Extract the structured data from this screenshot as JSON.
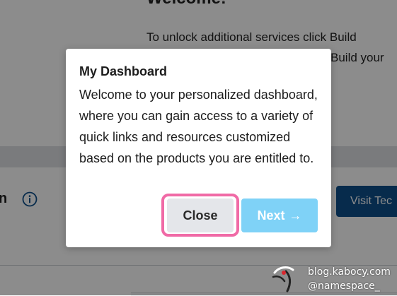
{
  "background": {
    "heading": "Welcome!",
    "intro_lines": [
      "To unlock additional services click Build",
      "Build your"
    ],
    "section_title_fragment": "n",
    "info_icon": "info-circle-icon",
    "visit_button_label": "Visit Tec"
  },
  "modal": {
    "title": "My Dashboard",
    "body": "Welcome to your personalized dashboard, where you can gain access to a variety of quick links and resources customized based on the products you are entitled to.",
    "close_label": "Close",
    "next_label": "Next",
    "next_icon": "arrow-right-icon",
    "next_arrow": "→",
    "highlight_color": "#f06aa6"
  },
  "watermark": {
    "logo_icon": "kabocy-logo",
    "line1": "blog.kabocy.com",
    "line2": "@namespace_"
  },
  "colors": {
    "overlay": "rgba(0,0,0,0.45)",
    "visit_button": "#0d4f8b",
    "next_button": "#7fd2f7",
    "close_button": "#e4e6ea"
  }
}
